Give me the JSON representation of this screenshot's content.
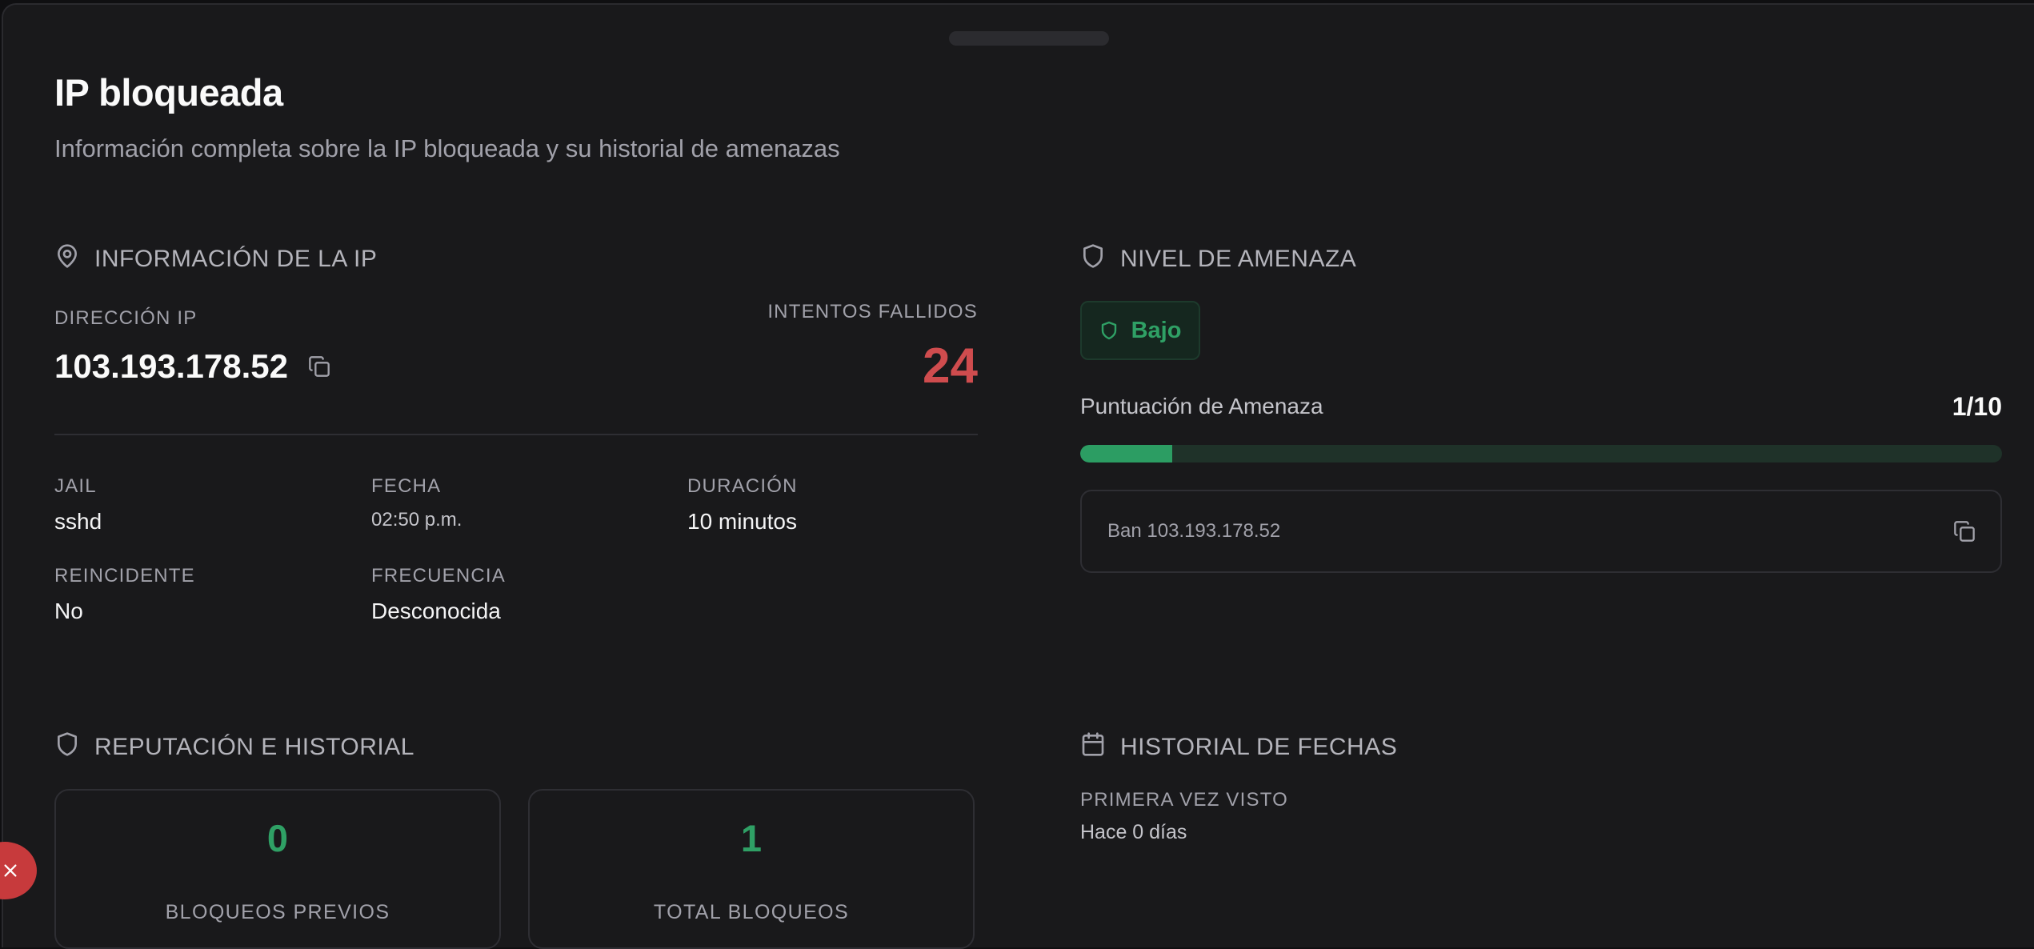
{
  "header": {
    "title": "IP bloqueada",
    "subtitle": "Información completa sobre la IP bloqueada y su historial de amenazas"
  },
  "ip_info": {
    "section_title": "INFORMACIÓN DE LA IP",
    "ip_label": "DIRECCIÓN IP",
    "ip_value": "103.193.178.52",
    "attempts_label": "INTENTOS FALLIDOS",
    "attempts_value": "24",
    "jail_label": "JAIL",
    "jail_value": "sshd",
    "date_label": "FECHA",
    "date_value": "02:50 p.m.",
    "duration_label": "DURACIÓN",
    "duration_value": "10 minutos",
    "repeat_label": "REINCIDENTE",
    "repeat_value": "No",
    "frequency_label": "FRECUENCIA",
    "frequency_value": "Desconocida"
  },
  "threat": {
    "section_title": "NIVEL DE AMENAZA",
    "badge_label": "Bajo",
    "score_label": "Puntuación de Amenaza",
    "score_text": "1/10",
    "score_fraction": 0.1,
    "command": "Ban 103.193.178.52"
  },
  "reputation": {
    "section_title": "REPUTACIÓN E HISTORIAL",
    "previous_value": "0",
    "previous_label": "BLOQUEOS PREVIOS",
    "total_value": "1",
    "total_label": "TOTAL BLOQUEOS"
  },
  "dates": {
    "section_title": "HISTORIAL DE FECHAS",
    "first_seen_label": "PRIMERA VEZ VISTO",
    "first_seen_value": "Hace 0 días"
  },
  "colors": {
    "background": "#19191b",
    "danger": "#cf4c4e",
    "success": "#2fa065",
    "muted": "#a1a1aa"
  },
  "icons": {
    "ip_section": "map-pin-icon",
    "threat_section": "shield-icon",
    "reputation_section": "shield-icon",
    "dates_section": "calendar-icon",
    "copy": "copy-icon",
    "close": "close-icon"
  }
}
